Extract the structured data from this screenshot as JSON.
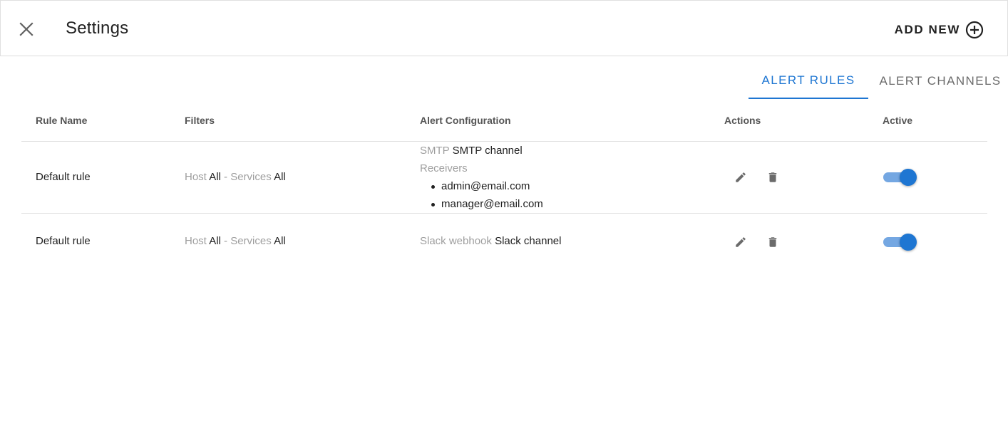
{
  "header": {
    "title": "Settings",
    "add_new_label": "ADD NEW"
  },
  "tabs": [
    {
      "label": "ALERT RULES",
      "active": true
    },
    {
      "label": "ALERT CHANNELS",
      "active": false
    }
  ],
  "table": {
    "columns": [
      "Rule Name",
      "Filters",
      "Alert Configuration",
      "Actions",
      "Active"
    ],
    "rows": [
      {
        "rule_name": "Default rule",
        "filters": {
          "host_label": "Host",
          "host_value": "All",
          "separator": " - ",
          "services_label": "Services",
          "services_value": "All"
        },
        "config": {
          "type_label": "SMTP",
          "channel": "SMTP channel",
          "receivers_label": "Receivers",
          "receivers": [
            "admin@email.com",
            "manager@email.com"
          ]
        },
        "active": true
      },
      {
        "rule_name": "Default rule",
        "filters": {
          "host_label": "Host",
          "host_value": "All",
          "separator": " - ",
          "services_label": "Services",
          "services_value": "All"
        },
        "config": {
          "type_label": "Slack webhook",
          "channel": "Slack channel"
        },
        "active": true
      }
    ]
  },
  "colors": {
    "accent": "#1e76d2",
    "switch_track": "#74a7e2",
    "muted_text": "#9e9e9e",
    "icon_gray": "#6b6b6b"
  },
  "icons": {
    "close": "close-icon",
    "add": "add-circle-icon",
    "edit": "pencil-icon",
    "delete": "trash-icon"
  }
}
